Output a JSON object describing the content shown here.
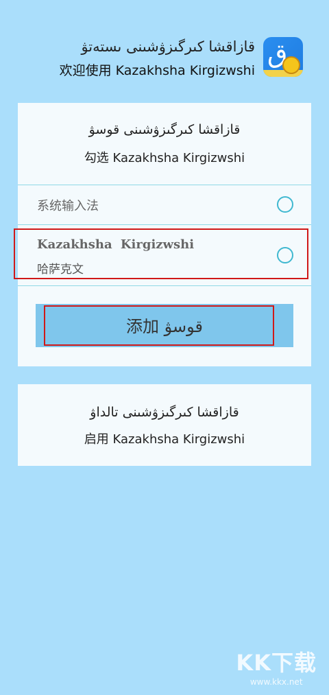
{
  "header": {
    "title_ug": "قازاقشا كىرگىزۋشىنى ىستەتۋ",
    "title_cn": "欢迎使用 Kazakhsha Kirgizwshi",
    "app_icon_glyph": "ق"
  },
  "select_card": {
    "title_ug": "قازاقشا كىرگىزۋشىنى قوسۋ",
    "title_cn": "勾选 Kazakhsha Kirgizwshi",
    "options": [
      {
        "label": "系统输入法"
      },
      {
        "title": "Kazakhsha  Kirgizwshi",
        "subtitle": "哈萨克文"
      }
    ],
    "add_button_label": "添加 قوسۋ"
  },
  "enable_card": {
    "title_ug": "قازاقشا كىرگىزۋشىنى تالداۋ",
    "title_cn": "启用 Kazakhsha Kirgizwshi"
  },
  "watermark": {
    "logo": "KK下载",
    "url": "www.kkx.net"
  },
  "colors": {
    "background": "#aadefb",
    "card": "#f4fafd",
    "button": "#7fc6ec",
    "radio": "#3fb8d0",
    "highlight": "#d01818"
  }
}
